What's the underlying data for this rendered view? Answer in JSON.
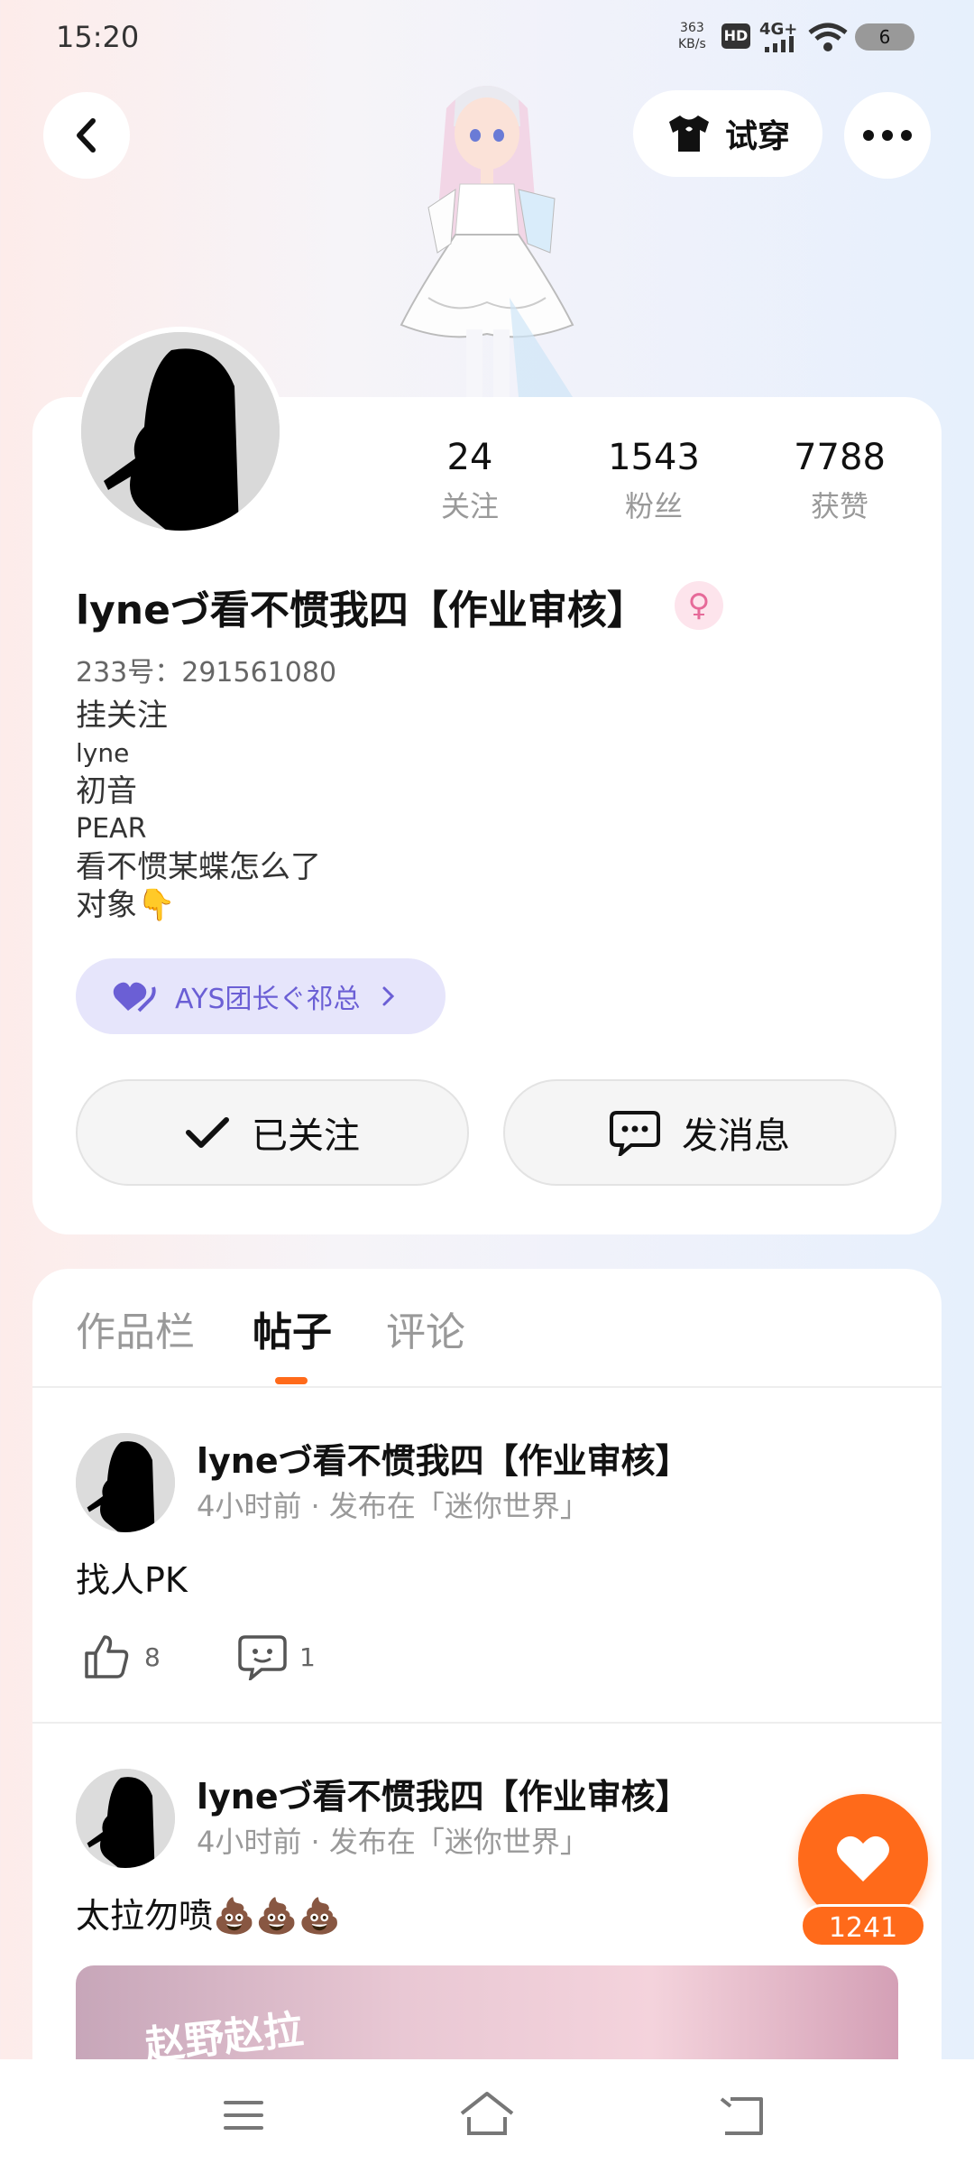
{
  "status_bar": {
    "time": "15:20",
    "net_speed_top": "363",
    "net_speed_bottom": "KB/s",
    "hd": "HD",
    "signal": "4G+",
    "battery": "6"
  },
  "header": {
    "tryon_label": "试穿"
  },
  "profile": {
    "stats": [
      {
        "value": "24",
        "label": "关注"
      },
      {
        "value": "1543",
        "label": "粉丝"
      },
      {
        "value": "7788",
        "label": "获赞"
      }
    ],
    "name": "lyneづ看不惯我四【作业审核】",
    "gender_symbol": "♀",
    "uid": "233号：291561080",
    "bio_lines": [
      "挂关注",
      "lyne",
      "初音",
      "PEAR",
      "看不惯某蝶怎么了",
      "对象👇"
    ],
    "badge_label": "AYS团长ぐ祁总",
    "follow_label": "已关注",
    "message_label": "发消息"
  },
  "tabs": [
    "作品栏",
    "帖子",
    "评论"
  ],
  "active_tab": "帖子",
  "posts": [
    {
      "author": "lyneづ看不惯我四【作业审核】",
      "meta": "4小时前 · 发布在「迷你世界」",
      "text": "找人PK",
      "likes": "8",
      "comments": "1"
    },
    {
      "author": "lyneづ看不惯我四【作业审核】",
      "meta": "4小时前 · 发布在「迷你世界」",
      "text": "太拉勿喷💩💩💩",
      "image_text": "赵野赵拉"
    }
  ],
  "floating_like": {
    "count": "1241"
  },
  "colors": {
    "accent": "#ff6a1a",
    "badge_bg": "#e6e5fb",
    "badge_text": "#6b5fd5",
    "gender_pink": "#e66a99"
  },
  "icons": {
    "back": "chevron-left-icon",
    "tryon": "tshirt-icon",
    "more": "more-icon",
    "badge": "heart-icon",
    "follow": "check-icon",
    "message": "chat-icon",
    "like": "thumbs-up-icon",
    "comment": "comment-icon",
    "fab": "heart-icon",
    "nav": [
      "menu-icon",
      "home-icon",
      "back-icon"
    ]
  }
}
